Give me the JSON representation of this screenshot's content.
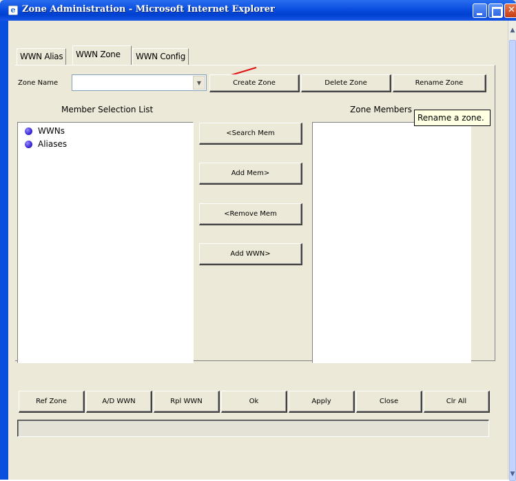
{
  "window": {
    "title": "Zone Administration - Microsoft Internet Explorer"
  },
  "tabs": [
    {
      "label": "WWN Alias",
      "active": false
    },
    {
      "label": "WWN Zone",
      "active": true
    },
    {
      "label": "WWN Config",
      "active": false
    }
  ],
  "zone_name": {
    "label": "Zone Name",
    "value": ""
  },
  "top_buttons": {
    "create": "Create Zone",
    "delete": "Delete Zone",
    "rename": "Rename Zone"
  },
  "member_selection": {
    "title": "Member Selection List",
    "items": [
      "WWNs",
      "Aliases"
    ]
  },
  "zone_members": {
    "title": "Zone Members"
  },
  "middle_buttons": {
    "search": "<Search Mem",
    "add_mem": "Add Mem>",
    "remove": "<Remove Mem",
    "add_wwn": "Add WWN>"
  },
  "tooltip": "Rename a zone.",
  "bottom_buttons": {
    "ref_zone": "Ref Zone",
    "ad_wwn": "A/D WWN",
    "rpl_wwn": "Rpl WWN",
    "ok": "Ok",
    "apply": "Apply",
    "close": "Close",
    "clr_all": "Clr All"
  },
  "status": "",
  "colors": {
    "titlebar": "#0a4ee0",
    "panel": "#ece9d8",
    "tooltip_bg": "#ffffe1",
    "annotation_arrow": "#e01010",
    "tree_node": "#4030d8"
  },
  "icons": {
    "window": "ie-icon",
    "tree_node": "purple-dot-icon",
    "annotation": "red-arrow-icon"
  }
}
